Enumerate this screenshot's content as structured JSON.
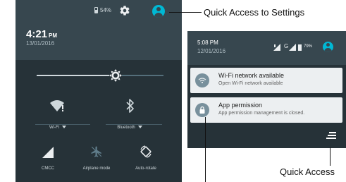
{
  "left_phone": {
    "battery_percent": "54%",
    "time": "4:21",
    "time_suffix": "PM",
    "date": "13/01/2016",
    "brightness_level": 0.62,
    "tiles_row1": [
      {
        "icon": "wifi-alert-icon",
        "label": "Wi-Fi"
      },
      {
        "icon": "bluetooth-icon",
        "label": "Bluetooth"
      }
    ],
    "tiles_row2": [
      {
        "icon": "cell-signal-icon",
        "label": "CMCC"
      },
      {
        "icon": "airplane-mode-icon",
        "label": "Airplane mode"
      },
      {
        "icon": "auto-rotate-icon",
        "label": "Auto-rotate"
      }
    ]
  },
  "right_phone": {
    "time": "5:08 PM",
    "date": "12/01/2016",
    "network": "G",
    "battery_percent": "79%",
    "notifications": [
      {
        "icon": "wifi-icon",
        "title": "Wi-Fi network available",
        "body": "Open Wi-Fi network available"
      },
      {
        "icon": "lock-icon",
        "title": "App permission",
        "body": "App permission management is closed."
      }
    ]
  },
  "annotations": {
    "settings": "Quick Access to Settings",
    "quick_access": "Quick Access"
  }
}
